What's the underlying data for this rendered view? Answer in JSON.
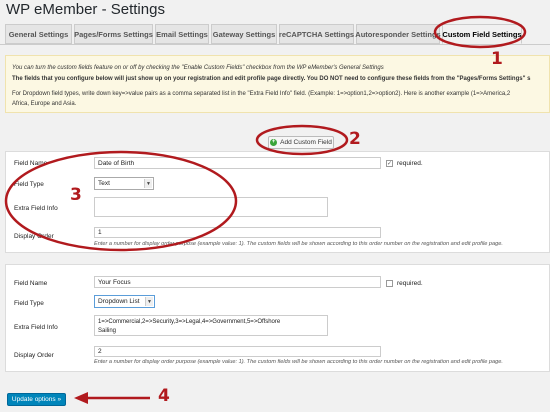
{
  "title": "WP eMember - Settings",
  "tabs": [
    {
      "label": "General Settings"
    },
    {
      "label": "Pages/Forms Settings"
    },
    {
      "label": "Email Settings"
    },
    {
      "label": "Gateway Settings"
    },
    {
      "label": "reCAPTCHA Settings"
    },
    {
      "label": "Autoresponder Settings"
    },
    {
      "label": "Custom Field Settings",
      "active": true
    }
  ],
  "notice": {
    "line1": "You can turn the custom fields feature on or off by checking the \"Enable Custom Fields\" checkbox from the WP eMember's General Settings",
    "line2": "The fields that you configure below will just show up on your registration and edit profile page directly. You DO NOT need to configure these fields from the \"Pages/Forms Settings\" s",
    "line3": "For Dropdown field types, write down key=>value pairs as a comma separated list in the \"Extra Field Info\" field. (Example: 1=>option1,2=>option2). Here is another example (1=>America,2",
    "line4": "Africa, Europe and Asia."
  },
  "add_button": {
    "label": "Add Custom Field",
    "icon": "plus-circle-icon"
  },
  "labels": {
    "field_name": "Field Name",
    "field_type": "Field Type",
    "extra_field_info": "Extra Field Info",
    "display_order": "Display Order",
    "required": "required."
  },
  "fields": [
    {
      "name": "Date of Birth",
      "type": "Text",
      "extra_info": "",
      "required": true,
      "order": "1",
      "hint": "Enter a number for display order purpose (example value: 1). The custom fields will be shown according to this order number on the registration and edit profile page."
    },
    {
      "name": "Your Focus",
      "type": "Dropdown List",
      "extra_info_line1": "1=>Commercial,2=>Security,3=>Legal,4=>Government,5=>Offshore",
      "extra_info_line2": "Sailing",
      "required": false,
      "order": "2",
      "hint": "Enter a number for display order purpose (example value: 1). The custom fields will be shown according to this order number on the registration and edit profile page."
    }
  ],
  "update_button": {
    "label": "Update options »"
  },
  "annotations": {
    "n1": "1",
    "n2": "2",
    "n3": "3",
    "n4": "4",
    "color": "#b11a1e"
  },
  "colors": {
    "primary_button": "#0085ba",
    "notice_bg": "#fcf8e3",
    "annotation_red": "#b11a1e"
  }
}
